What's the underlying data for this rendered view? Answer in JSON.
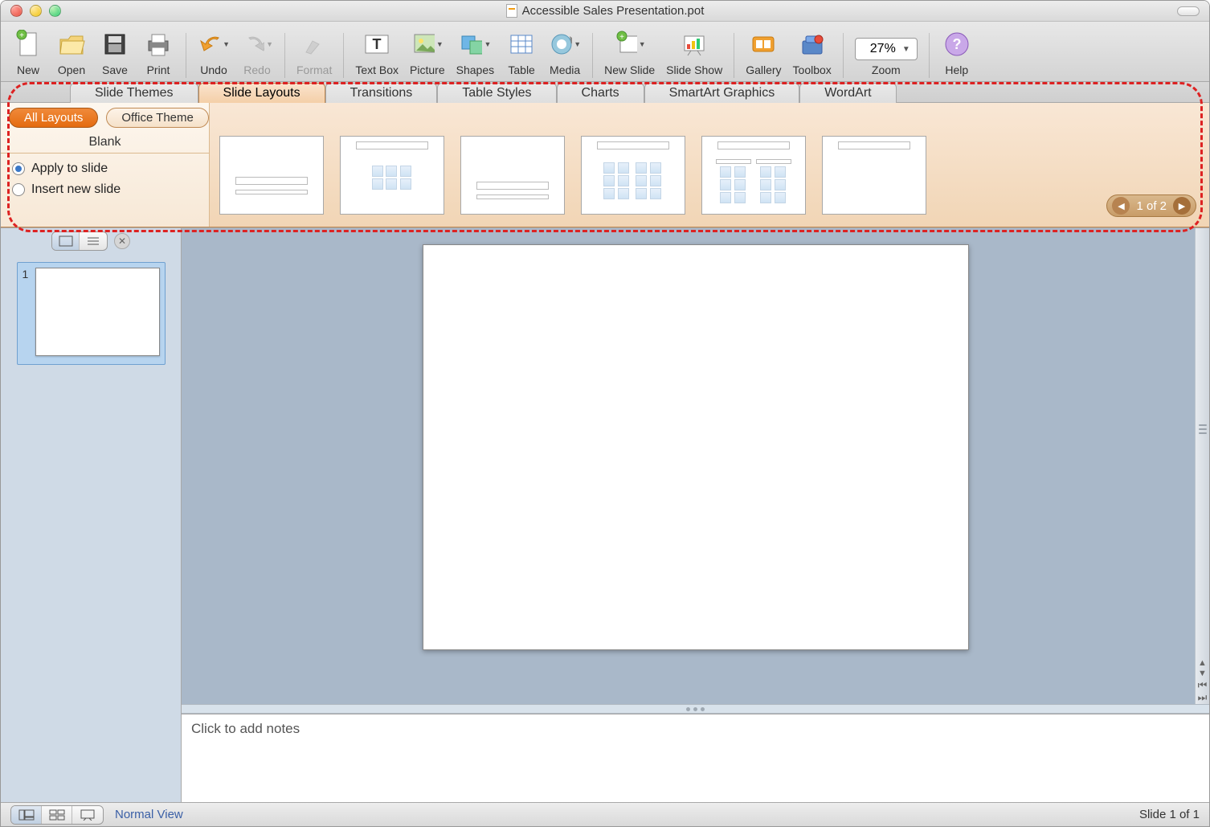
{
  "window": {
    "title": "Accessible Sales Presentation.pot"
  },
  "toolbar": [
    {
      "id": "new",
      "label": "New"
    },
    {
      "id": "open",
      "label": "Open"
    },
    {
      "id": "save",
      "label": "Save"
    },
    {
      "id": "print",
      "label": "Print"
    },
    {
      "id": "undo",
      "label": "Undo"
    },
    {
      "id": "redo",
      "label": "Redo",
      "disabled": true
    },
    {
      "id": "format",
      "label": "Format",
      "disabled": true
    },
    {
      "id": "textbox",
      "label": "Text Box"
    },
    {
      "id": "picture",
      "label": "Picture"
    },
    {
      "id": "shapes",
      "label": "Shapes"
    },
    {
      "id": "table",
      "label": "Table"
    },
    {
      "id": "media",
      "label": "Media"
    },
    {
      "id": "newslide",
      "label": "New Slide"
    },
    {
      "id": "slideshow",
      "label": "Slide Show"
    },
    {
      "id": "gallery",
      "label": "Gallery"
    },
    {
      "id": "toolbox",
      "label": "Toolbox"
    }
  ],
  "zoom": {
    "value": "27%",
    "label": "Zoom"
  },
  "help": {
    "label": "Help"
  },
  "ribbon_tabs": [
    "Slide Themes",
    "Slide Layouts",
    "Transitions",
    "Table Styles",
    "Charts",
    "SmartArt Graphics",
    "WordArt"
  ],
  "ribbon_active_index": 1,
  "layout_panel": {
    "pills": [
      "All Layouts",
      "Office Theme"
    ],
    "active_pill": 0,
    "heading": "Blank",
    "radios": [
      {
        "label": "Apply to slide",
        "checked": true
      },
      {
        "label": "Insert new slide",
        "checked": false
      }
    ],
    "pager": "1 of 2"
  },
  "side": {
    "slide_number": "1"
  },
  "notes": {
    "placeholder": "Click to add notes"
  },
  "status": {
    "view": "Normal View",
    "slide_info": "Slide 1 of 1"
  }
}
